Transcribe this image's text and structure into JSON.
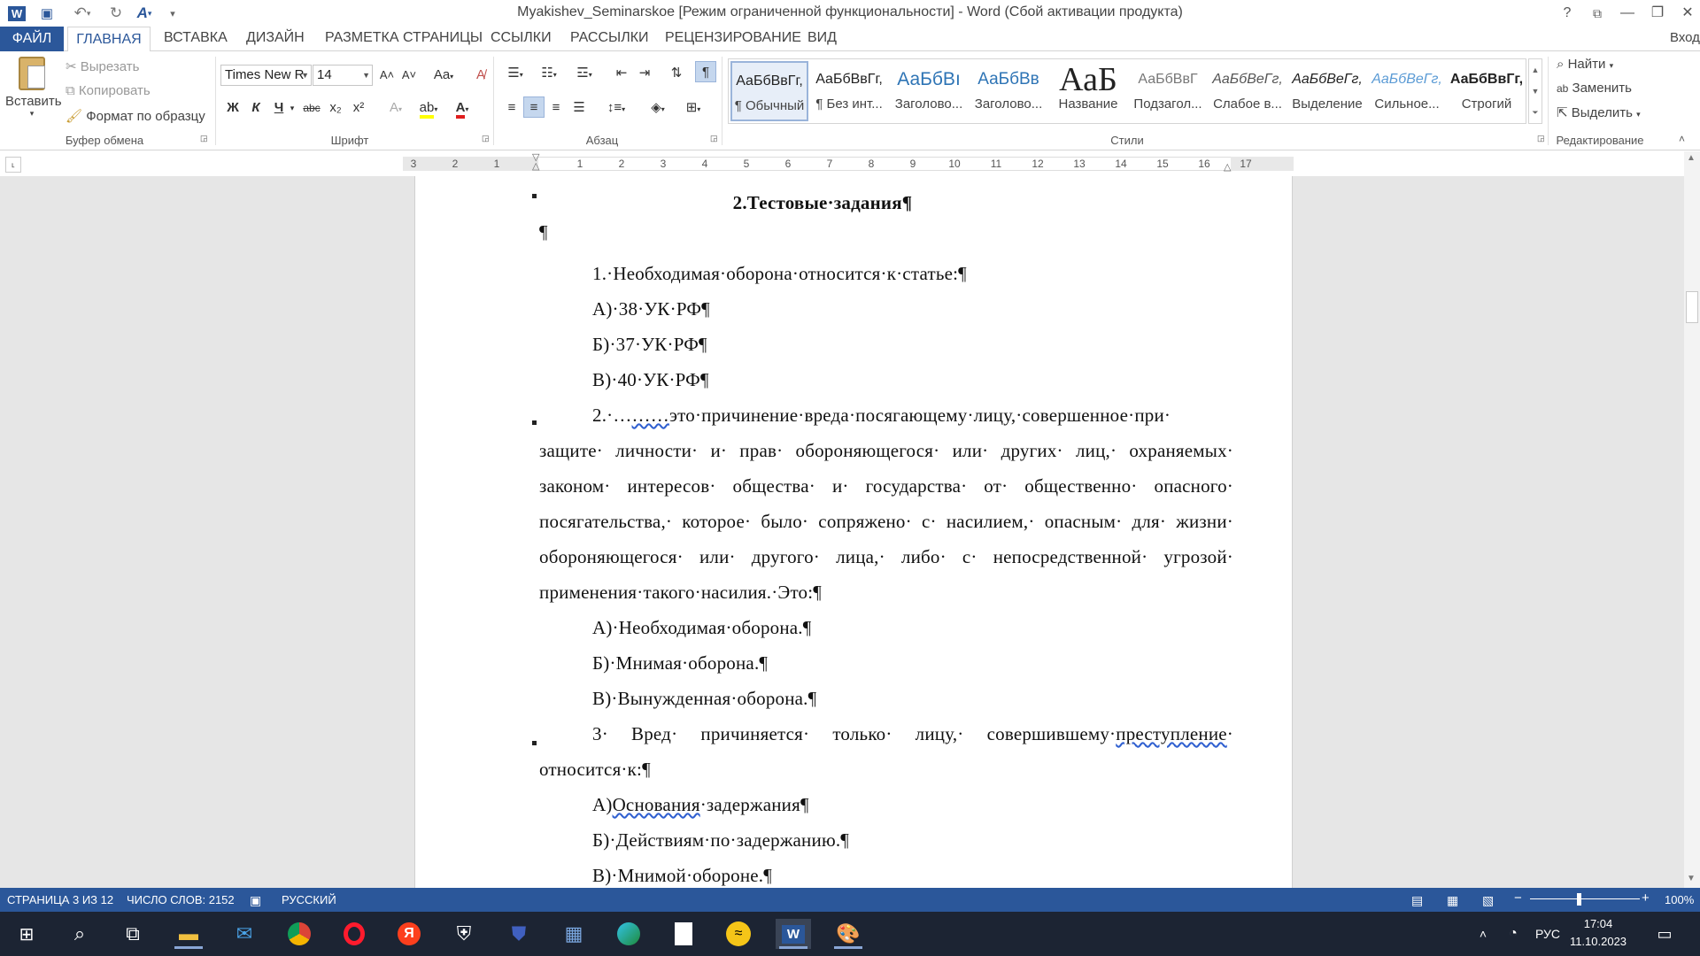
{
  "window": {
    "title": "Myakishev_Seminarskoe [Режим ограниченной функциональности] - Word (Сбой активации продукта)",
    "help": "?",
    "restore_ribbon": "⧉",
    "minimize": "—",
    "maximize": "❐",
    "close": "✕",
    "signin": "Вход"
  },
  "qat": {
    "word_icon": "W",
    "save_icon": "💾",
    "undo_icon": "↶",
    "redo_icon": "↻",
    "spell_icon": "A"
  },
  "tabs": {
    "file": "ФАЙЛ",
    "home": "ГЛАВНАЯ",
    "insert": "ВСТАВКА",
    "design": "ДИЗАЙН",
    "layout": "РАЗМЕТКА СТРАНИЦЫ",
    "references": "ССЫЛКИ",
    "mailings": "РАССЫЛКИ",
    "review": "РЕЦЕНЗИРОВАНИЕ",
    "view": "ВИД"
  },
  "clipboard": {
    "paste": "Вставить",
    "cut": "Вырезать",
    "copy": "Копировать",
    "format_painter": "Формат по образцу",
    "group": "Буфер обмена"
  },
  "font": {
    "name": "Times New R",
    "size": "14",
    "bold": "Ж",
    "italic": "К",
    "underline": "Ч",
    "strike": "abc",
    "sub": "x₂",
    "sup": "x²",
    "grow": "A˄",
    "shrink": "A˅",
    "case": "Aa",
    "group": "Шрифт"
  },
  "paragraph": {
    "group": "Абзац",
    "pilcrow": "¶"
  },
  "styles": {
    "group": "Стили",
    "items": [
      {
        "preview": "АаБбВвГг,",
        "name": "¶ Обычный"
      },
      {
        "preview": "АаБбВвГг,",
        "name": "¶ Без инт..."
      },
      {
        "preview": "АаБбВı",
        "name": "Заголово..."
      },
      {
        "preview": "АаБбВв",
        "name": "Заголово..."
      },
      {
        "preview": "АаБ",
        "name": "Название"
      },
      {
        "preview": "АаБбВвГ",
        "name": "Подзагол..."
      },
      {
        "preview": "АаБбВеГг,",
        "name": "Слабое в..."
      },
      {
        "preview": "АаБбВеГг,",
        "name": "Выделение"
      },
      {
        "preview": "АаБбВеГг,",
        "name": "Сильное..."
      },
      {
        "preview": "АаБбВвГг,",
        "name": "Строгий"
      }
    ]
  },
  "editing": {
    "find": "Найти",
    "replace": "Заменить",
    "select": "Выделить",
    "group": "Редактирование"
  },
  "ruler": {
    "left_ticks": [
      "3",
      "2",
      "1"
    ],
    "ticks": [
      "1",
      "2",
      "3",
      "4",
      "5",
      "6",
      "7",
      "8",
      "9",
      "10",
      "11",
      "12",
      "13",
      "14",
      "15",
      "16",
      "17"
    ]
  },
  "document": {
    "heading": "2.Тестовые·задания¶",
    "empty": "¶",
    "q1": "1.·Необходимая·оборона·относится·к·статье:¶",
    "q1a": "А)·38·УК·РФ¶",
    "q1b": "Б)·37·УК·РФ¶",
    "q1c": "В)·40·УК·РФ¶",
    "q2_start": "2.·…",
    "q2_blank": "……",
    "q2_l1": "это·причинение·вреда·посягающему·лицу,·совершенное·при·",
    "q2_l2": "защите· личности· и· прав· обороняющегося· или· других· лиц,· охраняемых·",
    "q2_l3": "законом· интересов· общества· и· государства· от· общественно· опасного·",
    "q2_l4": "посягательства,· которое· было· сопряжено· с· насилием,· опасным· для· жизни·",
    "q2_l5": "обороняющегося· или· другого· лица,· либо· с· непосредственной· угрозой·",
    "q2_l6": "применения·такого·насилия.·Это:¶",
    "q2a": "А)·Необходимая·оборона.¶",
    "q2b": "Б)·Мнимая·оборона.¶",
    "q2c": "В)·Вынужденная·оборона.¶",
    "q3_l1a": "3· Вред· причиняется· только· лицу,· совершившему·",
    "q3_l1b": "преступление",
    "q3_l2": "относится·к:¶",
    "q3a_pre": "А)",
    "q3a_word": "Основания",
    "q3a_post": "·задержания¶",
    "q3b": "Б)·Действиям·по·задержанию.¶",
    "q3c": "В)·Мнимой·обороне.¶"
  },
  "status": {
    "page": "СТРАНИЦА 3 ИЗ 12",
    "words": "ЧИСЛО СЛОВ: 2152",
    "lang": "РУССКИЙ",
    "zoom": "100%"
  },
  "taskbar": {
    "lang": "РУС",
    "time": "17:04",
    "date": "11.10.2023"
  },
  "colors": {
    "accent": "#2b579a",
    "taskbar": "#1c2433",
    "wavy": "#3060d0"
  }
}
